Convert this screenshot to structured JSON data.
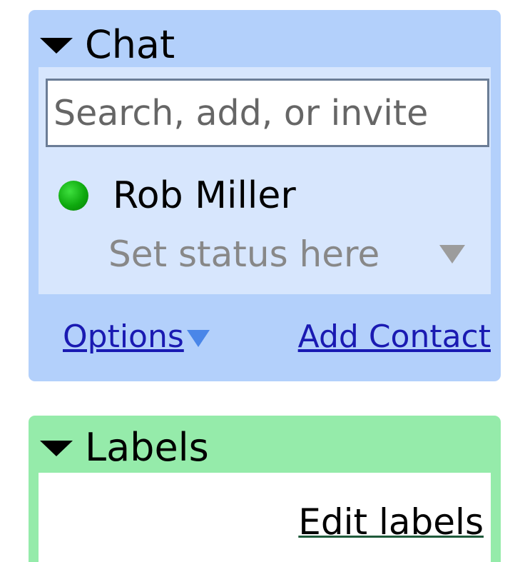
{
  "chat": {
    "title": "Chat",
    "search": {
      "placeholder": "Search, add, or invite",
      "value": ""
    },
    "user": {
      "name": "Rob Miller",
      "status_text": "Set status here",
      "presence_color": "#10aa10"
    },
    "footer": {
      "options_label": "Options",
      "add_contact_label": "Add Contact"
    },
    "colors": {
      "panel_bg": "#b3d0fb",
      "inner_bg": "#d7e6fd",
      "link": "#1a1ab2"
    }
  },
  "labels": {
    "title": "Labels",
    "edit_label": "Edit labels",
    "colors": {
      "panel_bg": "#95ebaa"
    }
  },
  "icons": {
    "collapse": "triangle-down-icon",
    "presence": "online-status-icon",
    "status_menu": "chevron-down-icon",
    "options_menu": "chevron-down-icon"
  }
}
